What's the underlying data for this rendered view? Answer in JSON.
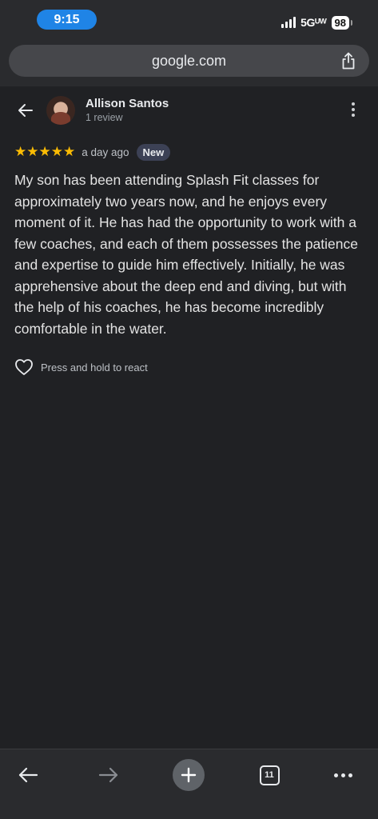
{
  "status_bar": {
    "time": "9:15",
    "network": "5Gᵁᵂ",
    "battery": "98"
  },
  "url_bar": {
    "domain": "google.com"
  },
  "review": {
    "reviewer_name": "Allison Santos",
    "reviewer_meta": "1 review",
    "stars_text": "★★★★★",
    "rating": 5,
    "date": "a day ago",
    "badge": "New",
    "text": "My son has been attending Splash Fit classes for approximately two years now, and he enjoys every moment of it. He has had the opportunity to work with a few coaches, and each of them possesses the patience and expertise to guide him effectively. Initially, he was apprehensive about the deep end and diving, but with the help of his coaches, he has become incredibly comfortable in the water.",
    "react_label": "Press and hold to react"
  },
  "toolbar": {
    "tab_count": "11"
  },
  "colors": {
    "background": "#202124",
    "accent_blue": "#1f84e6",
    "star": "#fbbc04",
    "badge_bg": "#3c4155"
  }
}
